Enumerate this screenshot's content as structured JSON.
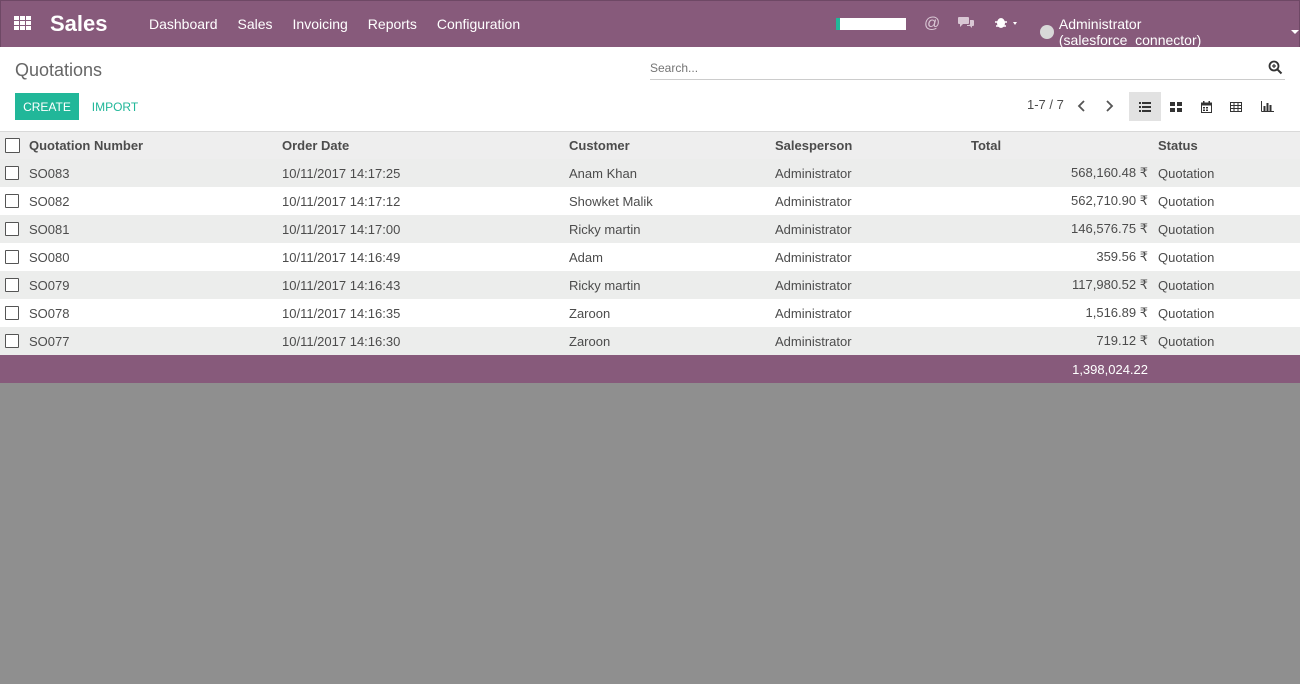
{
  "navbar": {
    "app_title": "Sales",
    "menu": [
      "Dashboard",
      "Sales",
      "Invoicing",
      "Reports",
      "Configuration"
    ],
    "user_label": "Administrator (salesforce_connector)"
  },
  "control": {
    "breadcrumb": "Quotations",
    "search_placeholder": "Search...",
    "create_label": "CREATE",
    "import_label": "IMPORT",
    "pager": "1-7 / 7"
  },
  "table": {
    "headers": [
      "Quotation Number",
      "Order Date",
      "Customer",
      "Salesperson",
      "Total",
      "Status"
    ],
    "rows": [
      {
        "number": "SO083",
        "date": "10/11/2017 14:17:25",
        "customer": "Anam Khan",
        "salesperson": "Administrator",
        "total": "568,160.48 ₹",
        "status": "Quotation"
      },
      {
        "number": "SO082",
        "date": "10/11/2017 14:17:12",
        "customer": "Showket Malik",
        "salesperson": "Administrator",
        "total": "562,710.90 ₹",
        "status": "Quotation"
      },
      {
        "number": "SO081",
        "date": "10/11/2017 14:17:00",
        "customer": "Ricky martin",
        "salesperson": "Administrator",
        "total": "146,576.75 ₹",
        "status": "Quotation"
      },
      {
        "number": "SO080",
        "date": "10/11/2017 14:16:49",
        "customer": "Adam",
        "salesperson": "Administrator",
        "total": "359.56 ₹",
        "status": "Quotation"
      },
      {
        "number": "SO079",
        "date": "10/11/2017 14:16:43",
        "customer": "Ricky martin",
        "salesperson": "Administrator",
        "total": "117,980.52 ₹",
        "status": "Quotation"
      },
      {
        "number": "SO078",
        "date": "10/11/2017 14:16:35",
        "customer": "Zaroon",
        "salesperson": "Administrator",
        "total": "1,516.89 ₹",
        "status": "Quotation"
      },
      {
        "number": "SO077",
        "date": "10/11/2017 14:16:30",
        "customer": "Zaroon",
        "salesperson": "Administrator",
        "total": "719.12 ₹",
        "status": "Quotation"
      }
    ],
    "sum_total": "1,398,024.22"
  },
  "colors": {
    "brand": "#875a7b",
    "accent": "#21b799",
    "background": "#8f8f8f"
  },
  "icons": [
    "apps-grid-icon",
    "at-sign-icon",
    "chat-icon",
    "bug-icon",
    "search-icon",
    "chevron-left-icon",
    "chevron-right-icon",
    "list-view-icon",
    "kanban-view-icon",
    "calendar-view-icon",
    "pivot-view-icon",
    "graph-view-icon"
  ]
}
